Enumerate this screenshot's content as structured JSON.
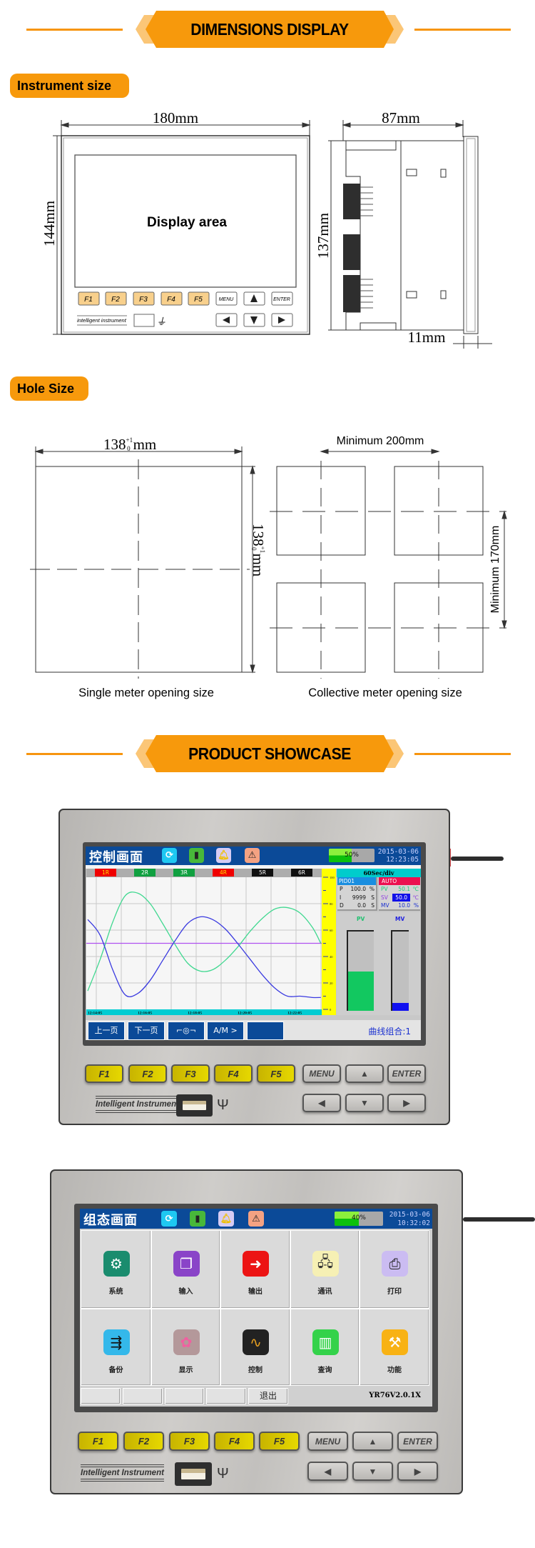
{
  "colors": {
    "accent_orange": "#f7990c",
    "accent_light": "#fbc677",
    "screen_blue": "#0b4a98"
  },
  "dimensions": {
    "banner": "DIMENSIONS DISPLAY",
    "instrument_size": {
      "label": "Instrument size",
      "width_dim": "180mm",
      "height_dim": "144mm",
      "display_label": "Display area",
      "depth_dim": "87mm",
      "side_height_dim": "137mm",
      "flange_dim": "11mm",
      "fkeys": [
        "F1",
        "F2",
        "F3",
        "F4",
        "F5"
      ],
      "menu_key": "MENU",
      "enter_key": "ENTER",
      "brand": "intelligent instrument"
    },
    "hole_size": {
      "label": "Hole Size",
      "single_dim": "138",
      "tol_upper": "+1",
      "tol_lower": "0",
      "unit": "mm",
      "min_width": "Minimum 200mm",
      "min_height": "Minimum  170mm",
      "single_caption": "Single meter opening size",
      "collective_caption": "Collective meter opening size"
    }
  },
  "showcase": {
    "banner": "PRODUCT SHOWCASE",
    "keypad": {
      "fkeys": [
        "F1",
        "F2",
        "F3",
        "F4",
        "F5"
      ],
      "menu": "MENU",
      "enter": "ENTER",
      "brand": "Intelligent  Instrument",
      "icons": [
        "up-arrow",
        "left-arrow",
        "down-arrow",
        "right-arrow",
        "usb-port",
        "usb-symbol"
      ]
    },
    "control_screen": {
      "title": "控制画面",
      "status_icons": [
        "refresh-icon",
        "usb-drive-icon",
        "bell-icon",
        "warning-icon"
      ],
      "progress_percent": 50,
      "progress_label": "50%",
      "date": "2015-03-06",
      "time": "12:23:05",
      "channel_tabs": [
        {
          "label": "1R",
          "bg": "#f00000",
          "fg": "#ffe000"
        },
        {
          "label": "2R",
          "bg": "#10a040",
          "fg": "#ffffff"
        },
        {
          "label": "3R",
          "bg": "#10a040",
          "fg": "#ffffff"
        },
        {
          "label": "4R",
          "bg": "#f00000",
          "fg": "#ffe000"
        },
        {
          "label": "5R",
          "bg": "#101010",
          "fg": "#ffffff"
        },
        {
          "label": "6R",
          "bg": "#101010",
          "fg": "#ffffff"
        }
      ],
      "trend": {
        "y_range": [
          0,
          100
        ],
        "y_ticks": [
          "100",
          "80",
          "60",
          "40",
          "20",
          "0"
        ],
        "time_labels": [
          "12:14:05",
          "12:16:05",
          "12:18:05",
          "12:20:05",
          "12:22:05"
        ],
        "times": [
          "12:14:05",
          "12:14:35",
          "12:15:05",
          "12:15:35",
          "12:16:05",
          "12:16:35",
          "12:17:05",
          "12:17:35",
          "12:18:05",
          "12:18:35",
          "12:19:05",
          "12:19:35",
          "12:20:05",
          "12:20:35",
          "12:21:05",
          "12:21:35",
          "12:22:05",
          "12:22:35",
          "12:23:05",
          "12:23:25"
        ],
        "series": [
          {
            "color": "#40d890",
            "values": [
              14,
              38,
              66,
              86,
              88,
              80,
              65,
              49,
              35,
              29,
              30,
              37,
              47,
              59,
              69,
              76,
              77,
              73,
              62,
              50
            ]
          },
          {
            "color": "#3a3ae0",
            "values": [
              68,
              56,
              30,
              11,
              12,
              22,
              37,
              52,
              65,
              70,
              68,
              61,
              50,
              38,
              26,
              16,
              10,
              10,
              9,
              9
            ]
          }
        ],
        "setpoint": {
          "color": "#b050f0",
          "value": 50
        }
      },
      "time_div": "60Sec/div",
      "pid": {
        "name": "PID01",
        "rows": [
          [
            "P",
            "100.0",
            "%"
          ],
          [
            "I",
            "9999",
            "S"
          ],
          [
            "D",
            "0.0",
            "S"
          ]
        ]
      },
      "mode": {
        "name": "AUTO",
        "rows": [
          [
            "PV",
            "50.1",
            "℃"
          ],
          [
            "SV",
            "50.0",
            "℃"
          ],
          [
            "MV",
            "10.0",
            "%"
          ]
        ]
      },
      "pv_label": "PV",
      "mv_label": "MV",
      "pv_percent": 50,
      "mv_percent": 10,
      "buttons": [
        "上一页",
        "下一页",
        "pump-icon",
        "A/M >",
        ""
      ],
      "curve_group": "曲线组合:1"
    },
    "config_screen": {
      "title": "组态画面",
      "progress_percent": 50,
      "progress_label": "40%",
      "date": "2015-03-06",
      "time": "10:32:02",
      "tiles": [
        {
          "label": "系统",
          "icon": "gear-icon",
          "bg": "#1a8c6e"
        },
        {
          "label": "输入",
          "icon": "input-icon",
          "bg": "#8a44c8"
        },
        {
          "label": "输出",
          "icon": "output-icon",
          "bg": "#ec1414"
        },
        {
          "label": "通讯",
          "icon": "communication-icon",
          "bg": "#f6f0b4"
        },
        {
          "label": "打印",
          "icon": "printer-icon",
          "bg": "#cbbcf2"
        },
        {
          "label": "备份",
          "icon": "backup-usb-icon",
          "bg": "#34b8ea"
        },
        {
          "label": "显示",
          "icon": "display-icon",
          "bg": "#b4989a"
        },
        {
          "label": "控制",
          "icon": "control-icon",
          "bg": "#222222"
        },
        {
          "label": "查询",
          "icon": "query-icon",
          "bg": "#34d24a"
        },
        {
          "label": "功能",
          "icon": "function-icon",
          "bg": "#f8b214"
        }
      ],
      "buttons": [
        "",
        "",
        "",
        "",
        "退出"
      ],
      "version": "YR76V2.0.1X"
    }
  }
}
